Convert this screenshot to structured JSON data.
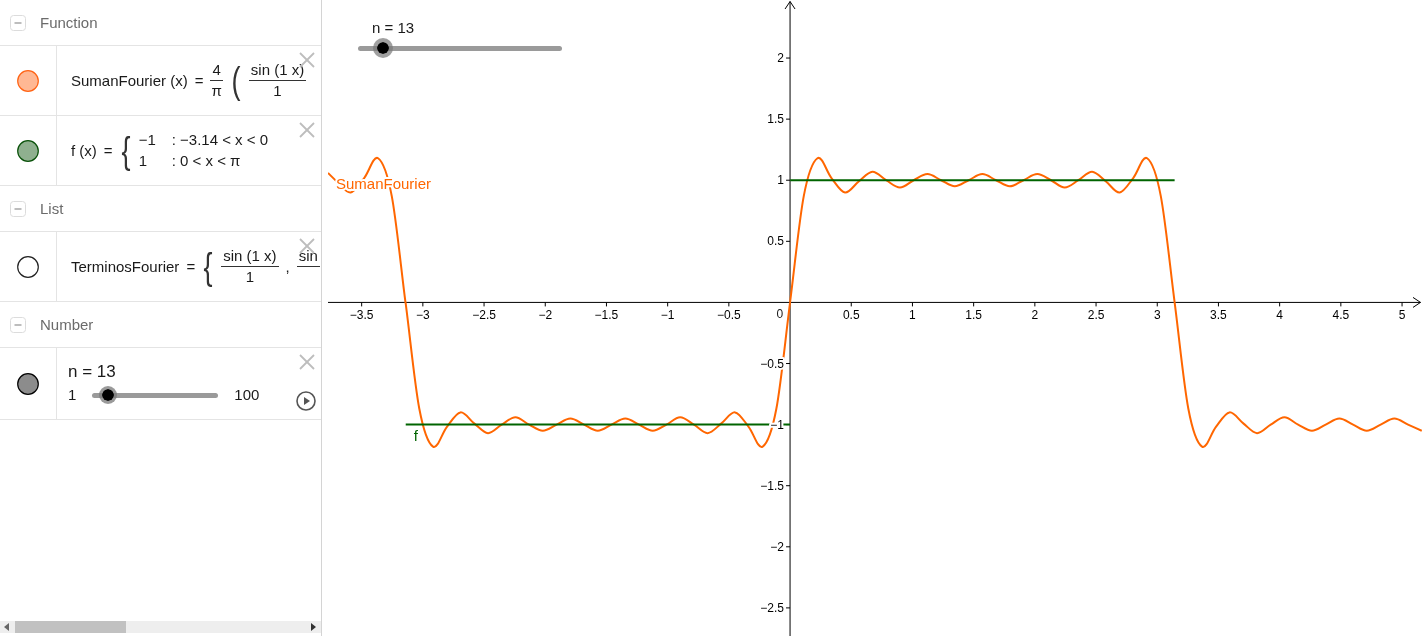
{
  "algebra": {
    "groups": [
      {
        "title": "Function",
        "expanded": true,
        "items": [
          {
            "kind": "formula",
            "visible": true,
            "color": "#ffb894",
            "tokens": [
              {
                "kind": "text",
                "text": "SumanFourier (x)"
              },
              {
                "kind": "text",
                "text": "="
              },
              {
                "kind": "frac",
                "num": "4",
                "den": "π"
              },
              {
                "kind": "delimiter",
                "text": "("
              },
              {
                "kind": "frac",
                "num": "sin (1 x)",
                "den": "1"
              }
            ]
          },
          {
            "kind": "formula",
            "visible": true,
            "color": "#8fb08f",
            "tokens": [
              {
                "kind": "text",
                "text": "f (x)"
              },
              {
                "kind": "text",
                "text": "="
              },
              {
                "kind": "delimiter",
                "text": "{"
              },
              {
                "kind": "cases",
                "rows": [
                  {
                    "value": "−1",
                    "condition": ": −3.14 < x < 0"
                  },
                  {
                    "value": "1",
                    "condition": ": 0 < x < π"
                  }
                ]
              }
            ]
          }
        ]
      },
      {
        "title": "List",
        "expanded": true,
        "items": [
          {
            "kind": "formula",
            "visible": false,
            "tokens": [
              {
                "kind": "text",
                "text": "TerminosFourier"
              },
              {
                "kind": "text",
                "text": "="
              },
              {
                "kind": "delimiter",
                "text": "{"
              },
              {
                "kind": "frac",
                "num": "sin (1 x)",
                "den": "1"
              },
              {
                "kind": "text",
                "text": ","
              },
              {
                "kind": "frac",
                "num": "sin"
              }
            ]
          }
        ]
      },
      {
        "title": "Number",
        "expanded": true,
        "items": [
          {
            "kind": "slider",
            "visible": true,
            "color": "#8c8c8c",
            "caption": "n = 13",
            "min": "1",
            "max": "100",
            "level": 0.121
          }
        ]
      }
    ]
  },
  "graphics": {
    "slider": {
      "caption": "n = 13",
      "level": 0.121
    },
    "chart_data": {
      "type": "line",
      "xlim": [
        -3.775,
        5.163
      ],
      "ylim": [
        -2.73,
        2.475
      ],
      "xticks": [
        {
          "value": -3.5,
          "label": "−3.5"
        },
        {
          "value": -3,
          "label": "−3"
        },
        {
          "value": -2.5,
          "label": "−2.5"
        },
        {
          "value": -2,
          "label": "−2"
        },
        {
          "value": -1.5,
          "label": "−1.5"
        },
        {
          "value": -1,
          "label": "−1"
        },
        {
          "value": -0.5,
          "label": "−0.5"
        },
        0.5,
        1,
        1.5,
        2,
        2.5,
        3,
        3.5,
        4,
        4.5,
        5
      ],
      "yticks": [
        {
          "value": -2.5,
          "label": "−2.5"
        },
        {
          "value": -2,
          "label": "−2"
        },
        {
          "value": -1.5,
          "label": "−1.5"
        },
        {
          "value": -1,
          "label": "−1"
        },
        {
          "value": -0.5,
          "label": "−0.5"
        },
        0.5,
        1,
        1.5,
        2
      ],
      "x": [
        -3.775,
        -3.703,
        -3.59,
        -3.478,
        -3.366,
        -3.254,
        -3.142,
        -3.14,
        -3.029,
        -2.917,
        -2.805,
        -2.693,
        -2.581,
        -2.468,
        -2.356,
        -2.244,
        -2.132,
        -2.02,
        -1.907,
        -1.795,
        -1.683,
        -1.571,
        -1.459,
        -1.346,
        -1.234,
        -1.122,
        -1.01,
        -0.898,
        -0.785,
        -0.673,
        -0.561,
        -0.449,
        -0.337,
        -0.224,
        -0.112,
        -0.001,
        0,
        0.001,
        0.112,
        0.224,
        0.337,
        0.449,
        0.561,
        0.673,
        0.785,
        0.898,
        1.01,
        1.122,
        1.234,
        1.346,
        1.459,
        1.571,
        1.683,
        1.795,
        1.907,
        2.02,
        2.132,
        2.244,
        2.356,
        2.468,
        2.581,
        2.693,
        2.805,
        2.917,
        3.029,
        3.142,
        3.254,
        3.366,
        3.478,
        3.59,
        3.703,
        3.815,
        3.927,
        4.039,
        4.151,
        4.264,
        4.376,
        4.488,
        4.6,
        4.712,
        4.825,
        4.937,
        5.049,
        5.161
      ],
      "series": [
        {
          "color": "#ff6600",
          "values": [
            1.06,
            0.99,
            0.9,
            1.02,
            1.18,
            0.87,
            0,
            -0.01,
            -0.87,
            -1.18,
            -1.02,
            -0.9,
            -0.99,
            -1.07,
            -1,
            -0.94,
            -1,
            -1.05,
            -1,
            -0.95,
            -1,
            -1.05,
            -1,
            -0.95,
            -1,
            -1.05,
            -1,
            -0.94,
            -1,
            -1.07,
            -0.99,
            -0.9,
            -1.02,
            -1.18,
            -0.87,
            -0.01,
            0,
            0.01,
            0.87,
            1.18,
            1.02,
            0.9,
            0.99,
            1.07,
            1,
            0.94,
            1,
            1.05,
            1,
            0.95,
            1,
            1.05,
            1,
            0.95,
            1,
            1.05,
            1,
            0.94,
            1,
            1.07,
            0.99,
            0.9,
            1.02,
            1.18,
            0.87,
            0,
            -0.87,
            -1.18,
            -1.02,
            -0.9,
            -0.99,
            -1.07,
            -1,
            -0.94,
            -1,
            -1.05,
            -1,
            -0.95,
            -1,
            -1.05,
            -1,
            -0.95,
            -1,
            -1.05
          ]
        },
        {
          "color": "#006400",
          "values": [
            null,
            null,
            null,
            null,
            null,
            null,
            null,
            -1,
            -1,
            -1,
            -1,
            -1,
            -1,
            -1,
            -1,
            -1,
            -1,
            -1,
            -1,
            -1,
            -1,
            -1,
            -1,
            -1,
            -1,
            -1,
            -1,
            -1,
            -1,
            -1,
            -1,
            -1,
            -1,
            -1,
            -1,
            -1,
            null,
            1,
            1,
            1,
            1,
            1,
            1,
            1,
            1,
            1,
            1,
            1,
            1,
            1,
            1,
            1,
            1,
            1,
            1,
            1,
            1,
            1,
            1,
            1,
            1,
            1,
            1,
            1,
            1,
            1,
            null,
            null,
            null,
            null,
            null,
            null,
            null,
            null,
            null,
            null,
            null,
            null,
            null,
            null,
            null,
            null,
            null,
            null
          ]
        }
      ],
      "annotations": [
        "SumanFourier",
        "f",
        "0"
      ]
    }
  }
}
